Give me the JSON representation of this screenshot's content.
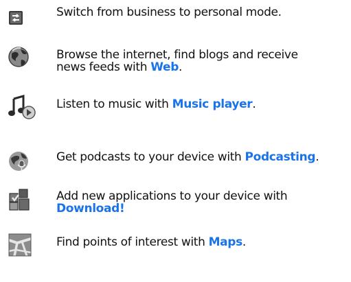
{
  "items": [
    {
      "icon": "mode-switch-icon",
      "before": "Switch from business to personal mode.",
      "link": "",
      "after": ""
    },
    {
      "icon": "globe-icon",
      "before": "Browse the internet, find blogs and receive news feeds with ",
      "link": "Web",
      "after": "."
    },
    {
      "icon": "music-note-icon",
      "before": "Listen to music with ",
      "link": "Music player",
      "after": "."
    },
    {
      "icon": "podcast-icon",
      "before": "Get podcasts to your device with ",
      "link": "Podcasting",
      "after": "."
    },
    {
      "icon": "download-icon",
      "before": "Add new applications to your device with ",
      "link": "Download!",
      "after": ""
    },
    {
      "icon": "map-icon",
      "before": "Find points of interest with ",
      "link": "Maps",
      "after": "."
    }
  ],
  "colors": {
    "link": "#1a73e8",
    "text": "#111111"
  }
}
